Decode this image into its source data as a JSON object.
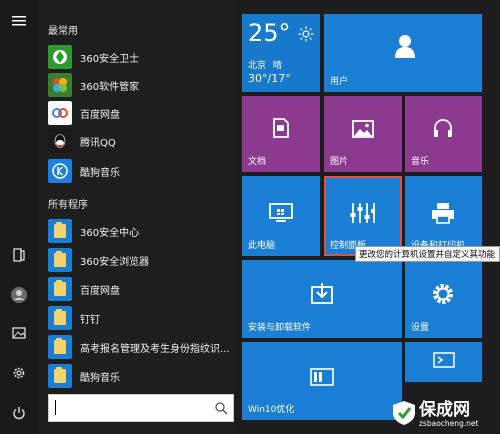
{
  "sidebar": {
    "icons": [
      "hamburger-menu-icon",
      "document-icon",
      "user-avatar-icon",
      "pictures-icon",
      "settings-gear-icon",
      "power-icon"
    ]
  },
  "menu": {
    "frequent_title": "最常用",
    "frequent_items": [
      {
        "label": "360安全卫士",
        "icon": "360-safe-icon",
        "color": "#2f9a2f"
      },
      {
        "label": "360软件管家",
        "icon": "360-software-manager-icon",
        "color": "#e04e2b"
      },
      {
        "label": "百度网盘",
        "icon": "baidu-netdisk-icon",
        "color": "#ffffff"
      },
      {
        "label": "腾讯QQ",
        "icon": "qq-icon",
        "color": "#1a1a1a"
      },
      {
        "label": "酷狗音乐",
        "icon": "kugou-music-icon",
        "color": "#1d7fe0"
      }
    ],
    "all_programs_title": "所有程序",
    "program_items": [
      {
        "label": "360安全中心",
        "icon": "folder-icon"
      },
      {
        "label": "360安全浏览器",
        "icon": "folder-icon"
      },
      {
        "label": "百度网盘",
        "icon": "folder-icon"
      },
      {
        "label": "钉钉",
        "icon": "folder-icon"
      },
      {
        "label": "高考报名管理及考生身份指纹识...",
        "icon": "folder-icon"
      },
      {
        "label": "酷狗音乐",
        "icon": "folder-icon"
      }
    ],
    "search_value": ""
  },
  "tiles": {
    "weather": {
      "temp": "25°",
      "location": "北京",
      "condition": "晴",
      "range": "30°/17°"
    },
    "user": "用户",
    "documents": "文档",
    "pictures": "图片",
    "music": "音乐",
    "this_pc": "此电脑",
    "control_panel": "控制面板",
    "devices": "设备和打印机",
    "install_uninstall": "安装与卸载软件",
    "settings": "设置",
    "win10": "Win10优化"
  },
  "tooltip": "更改您的计算机设置并自定义其功能",
  "watermark": {
    "title": "保成网",
    "url": "zsbaocheng.net"
  },
  "colors": {
    "tile_blue": "#1a7fd4",
    "tile_purple": "#8c3a8f",
    "highlight": "#d9534f"
  }
}
